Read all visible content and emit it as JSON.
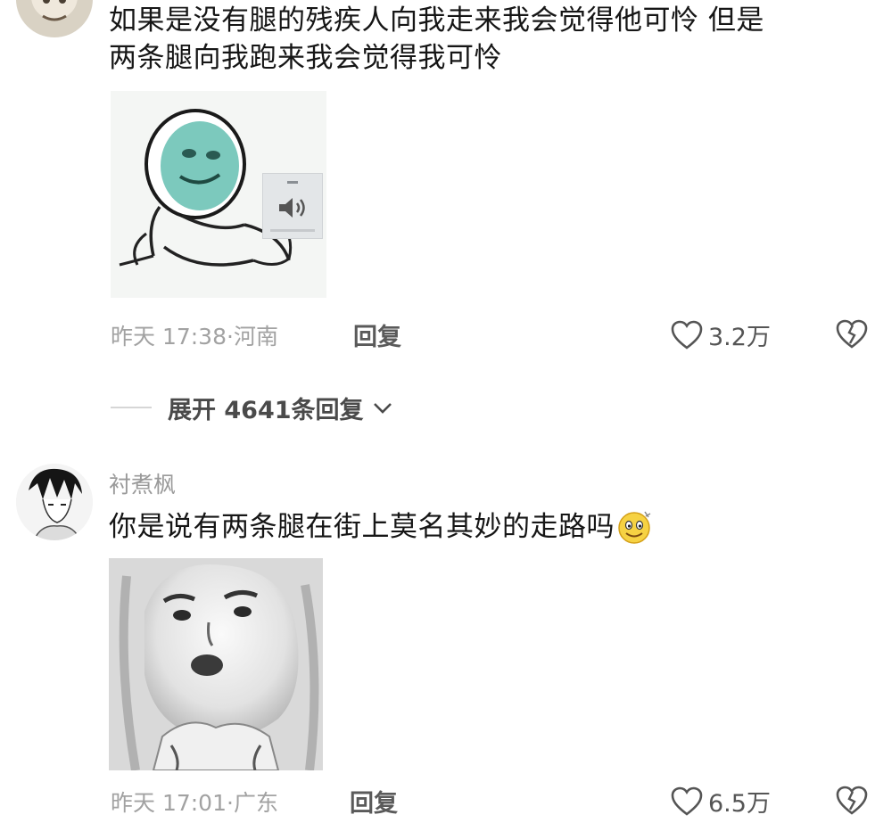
{
  "comments": [
    {
      "text": "如果是没有腿的残疾人向我走来我会觉得他可怜 但是两条腿向我跑来我会觉得我可怜",
      "text_line1": "如果是没有腿的残疾人向我走来我会觉得他可怜 但是",
      "text_line2": "两条腿向我跑来我会觉得我可怜",
      "time": "昨天 17:38",
      "location": "河南",
      "reply_label": "回复",
      "likes": "3.2万",
      "expand_label": "展开 4641条回复"
    },
    {
      "username": "衬煮枫",
      "text": "你是说有两条腿在街上莫名其妙的走路吗",
      "time": "昨天 17:01",
      "location": "广东",
      "reply_label": "回复",
      "likes": "6.5万"
    }
  ],
  "icons": {
    "like": "heart-outline-icon",
    "dislike": "broken-heart-icon",
    "expand": "chevron-down-icon",
    "emoji": "smiley-emoji-icon",
    "sound": "speaker-icon"
  },
  "colors": {
    "meta_text": "#a2a2a2",
    "body_text": "#161616"
  }
}
